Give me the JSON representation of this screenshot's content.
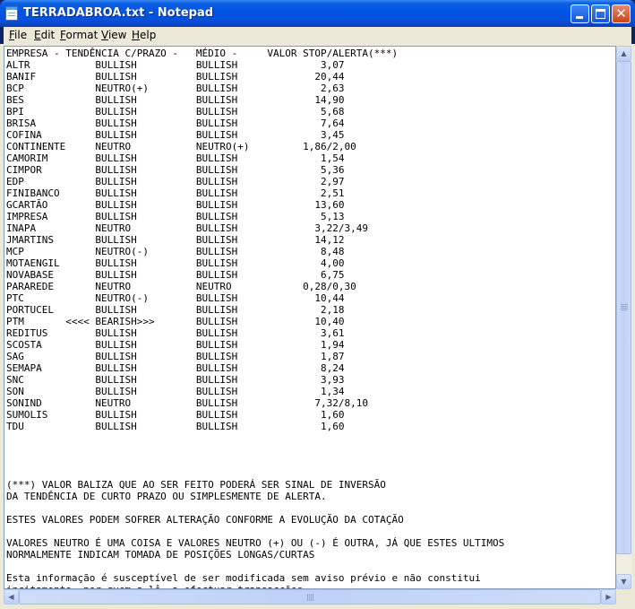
{
  "window": {
    "title": "TERRADABROA.txt - Notepad"
  },
  "controls": {
    "close_glyph": "✕"
  },
  "menu": [
    {
      "accel": "F",
      "rest": "ile"
    },
    {
      "accel": "E",
      "rest": "dit"
    },
    {
      "accel": "F",
      "rest": "ormat",
      "accel_pos": "first"
    },
    {
      "accel": "V",
      "rest": "iew"
    },
    {
      "accel": "H",
      "rest": "elp"
    }
  ],
  "document": {
    "lines": [
      "EMPRESA - TENDÊNCIA C/PRAZO -   MÉDIO -     VALOR STOP/ALERTA(***)",
      "ALTR           BULLISH          BULLISH              3,07",
      "BANIF          BULLISH          BULLISH             20,44",
      "BCP            NEUTRO(+)        BULLISH              2,63",
      "BES            BULLISH          BULLISH             14,90",
      "BPI            BULLISH          BULLISH              5,68",
      "BRISA          BULLISH          BULLISH              7,64",
      "COFINA         BULLISH          BULLISH              3,45",
      "CONTINENTE     NEUTRO           NEUTRO(+)         1,86/2,00",
      "CAMORIM        BULLISH          BULLISH              1,54",
      "CIMPOR         BULLISH          BULLISH              5,36",
      "EDP            BULLISH          BULLISH              2,97",
      "FINIBANCO      BULLISH          BULLISH              2,51",
      "GCARTÃO        BULLISH          BULLISH             13,60",
      "IMPRESA        BULLISH          BULLISH              5,13",
      "INAPA          NEUTRO           BULLISH             3,22/3,49",
      "JMARTINS       BULLISH          BULLISH             14,12",
      "MCP            NEUTRO(-)        BULLISH              8,48",
      "MOTAENGIL      BULLISH          BULLISH              4,00",
      "NOVABASE       BULLISH          BULLISH              6,75",
      "PARAREDE       NEUTRO           NEUTRO            0,28/0,30",
      "PTC            NEUTRO(-)        BULLISH             10,44",
      "PORTUCEL       BULLISH          BULLISH              2,18",
      "PTM       <<<< BEARISH>>>       BULLISH             10,40",
      "REDITUS        BULLISH          BULLISH              3,61",
      "SCOSTA         BULLISH          BULLISH              1,94",
      "SAG            BULLISH          BULLISH              1,87",
      "SEMAPA         BULLISH          BULLISH              8,24",
      "SNC            BULLISH          BULLISH              3,93",
      "SON            BULLISH          BULLISH              1,34",
      "SONIND         NEUTRO           BULLISH             7,32/8,10",
      "SUMOLIS        BULLISH          BULLISH              1,60",
      "TDU            BULLISH          BULLISH              1,60",
      "",
      "",
      "",
      "",
      "(***) VALOR BALIZA QUE AO SER FEITO PODERÁ SER SINAL DE INVERSÃO",
      "DA TENDÊNCIA DE CURTO PRAZO OU SIMPLESMENTE DE ALERTA.",
      "",
      "ESTES VALORES PODEM SOFRER ALTERAÇÃO CONFORME A EVOLUÇÃO DA COTAÇÃO",
      "",
      "VALORES NEUTRO É UMA COISA E VALORES NEUTRO (+) OU (-) É OUTRA, JÁ QUE ESTES ULTIMOS",
      "NORMALMENTE INDICAM TOMADA DE POSIÇÕES LONGAS/CURTAS",
      "",
      "Esta informação é susceptível de ser modificada sem aviso prévio e não constitui",
      "incitamento, por quem a lê, a efectuar transacções"
    ]
  },
  "scroll": {
    "up_glyph": "▲",
    "down_glyph": "▼",
    "left_glyph": "◀",
    "right_glyph": "▶"
  },
  "colors": {
    "titlebar": "#0054e3",
    "chrome": "#ece9d8",
    "text": "#000000"
  }
}
